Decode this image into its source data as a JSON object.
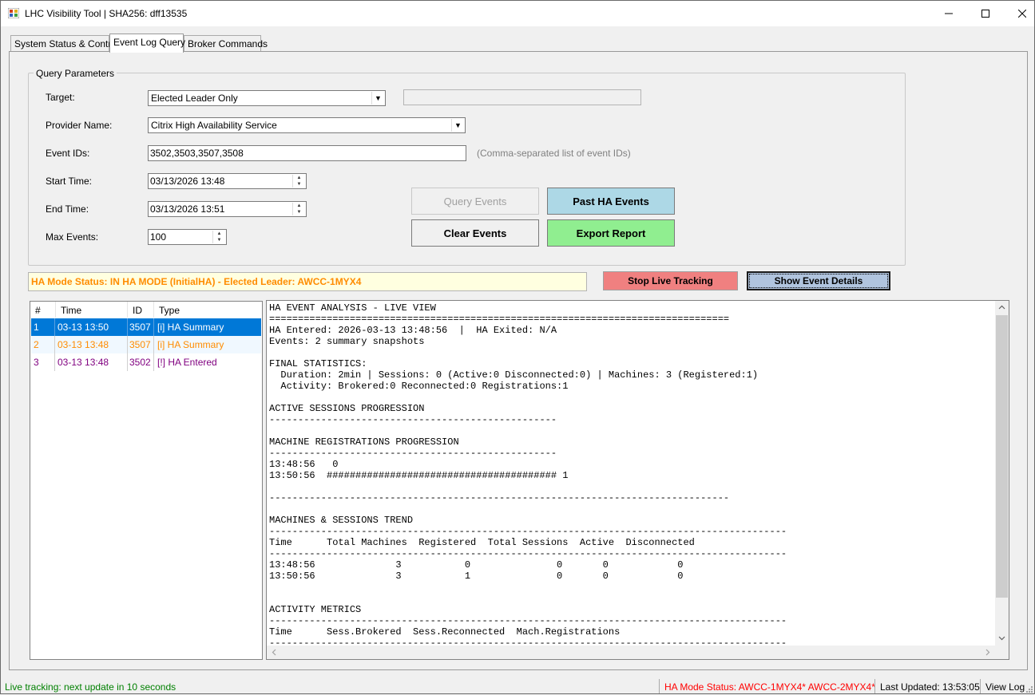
{
  "window": {
    "title": "LHC Visibility Tool | SHA256: dff13535",
    "minimize": "—",
    "maximize": "☐",
    "close": "✕"
  },
  "tabs": [
    "System Status & Control",
    "Event Log Query",
    "Broker Commands"
  ],
  "query": {
    "group_title": "Query Parameters",
    "target_label": "Target:",
    "target_value": "Elected Leader Only",
    "provider_label": "Provider Name:",
    "provider_value": "Citrix High Availability Service",
    "eventids_label": "Event IDs:",
    "eventids_value": "3502,3503,3507,3508",
    "eventids_hint": "(Comma-separated list of event IDs)",
    "start_label": "Start Time:",
    "start_value": "03/13/2026 13:48",
    "end_label": "End Time:",
    "end_value": "03/13/2026 13:51",
    "max_label": "Max Events:",
    "max_value": "100"
  },
  "buttons": {
    "query_events": "Query Events",
    "past_ha_events": "Past HA Events",
    "clear_events": "Clear Events",
    "export_report": "Export Report",
    "stop_live_tracking": "Stop Live Tracking",
    "show_event_details": "Show Event Details"
  },
  "ha_status": "HA Mode Status: IN HA MODE (InitialHA) - Elected Leader: AWCC-1MYX4",
  "event_list": {
    "headers": [
      "#",
      "Time",
      "ID",
      "Type"
    ],
    "rows": [
      {
        "num": "1",
        "time": "03-13 13:50",
        "id": "3507",
        "type": "[i] HA Summary",
        "color": "#ffffff",
        "bg": "#0078d7"
      },
      {
        "num": "2",
        "time": "03-13 13:48",
        "id": "3507",
        "type": "[i] HA Summary",
        "color": "#ff8c00",
        "bg": "#f0f8ff"
      },
      {
        "num": "3",
        "time": "03-13 13:48",
        "id": "3502",
        "type": "[!] HA Entered",
        "color": "#800080",
        "bg": "#ffffff"
      }
    ]
  },
  "report_text": "HA EVENT ANALYSIS - LIVE VIEW\n================================================================================\nHA Entered: 2026-03-13 13:48:56  |  HA Exited: N/A\nEvents: 2 summary snapshots\n\nFINAL STATISTICS:\n  Duration: 2min | Sessions: 0 (Active:0 Disconnected:0) | Machines: 3 (Registered:1)\n  Activity: Brokered:0 Reconnected:0 Registrations:1\n\nACTIVE SESSIONS PROGRESSION\n--------------------------------------------------\n\nMACHINE REGISTRATIONS PROGRESSION\n--------------------------------------------------\n13:48:56   0\n13:50:56  ######################################## 1\n\n--------------------------------------------------------------------------------\n\nMACHINES & SESSIONS TREND\n------------------------------------------------------------------------------------------\nTime      Total Machines  Registered  Total Sessions  Active  Disconnected\n------------------------------------------------------------------------------------------\n13:48:56              3           0               0       0            0\n13:50:56              3           1               0       0            0\n\n\nACTIVITY METRICS\n------------------------------------------------------------------------------------------\nTime      Sess.Brokered  Sess.Reconnected  Mach.Registrations\n------------------------------------------------------------------------------------------",
  "statusbar": {
    "live": "Live tracking: next update in 10 seconds",
    "ha_mode": "HA Mode Status: AWCC-1MYX4* AWCC-2MYX4*",
    "last_updated": "Last Updated: 13:53:05",
    "view_log": "View Log"
  },
  "colors": {
    "past_ha_bg": "#add8e6",
    "export_bg": "#90ee90",
    "stop_bg": "#f08080",
    "details_bg": "#b0c4de",
    "live_text": "#008000",
    "ha_text": "#ff0000"
  }
}
